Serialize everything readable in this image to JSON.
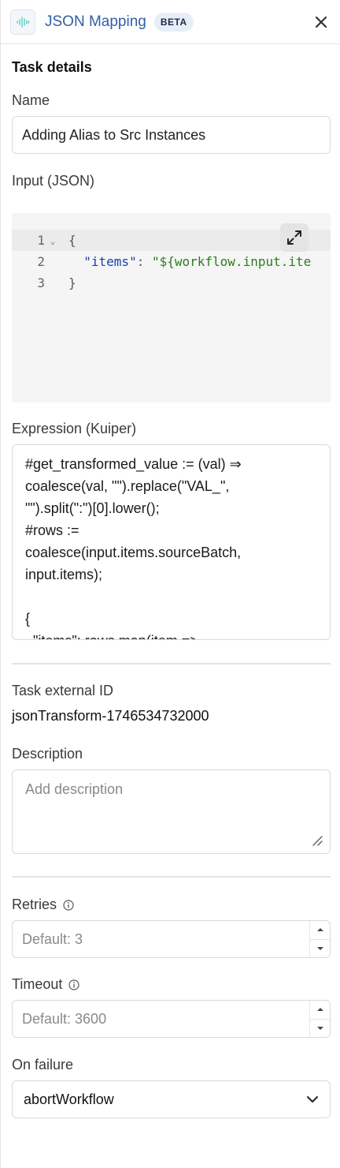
{
  "header": {
    "title": "JSON Mapping",
    "badge": "BETA"
  },
  "task_details": {
    "section_title": "Task details",
    "name_label": "Name",
    "name_value": "Adding Alias to Src Instances",
    "input_label": "Input (JSON)",
    "input_code": {
      "line_numbers": [
        "1",
        "2",
        "3"
      ],
      "line1": "{",
      "line2_key": "\"items\"",
      "line2_colon": ": ",
      "line2_value": "\"${workflow.input.ite",
      "line3": "}"
    },
    "expression_label": "Expression (Kuiper)",
    "expression_lines": [
      "#get_transformed_value := (val) ⇒",
      "coalesce(val, \"\").replace(\"VAL_\",",
      "\"\").split(\":\")[0].lower();",
      "#rows :=",
      "coalesce(input.items.sourceBatch,",
      "input.items);",
      "",
      "{",
      "  \"items\": rows.map(item =>"
    ],
    "external_id_label": "Task external ID",
    "external_id_value": "jsonTransform-1746534732000",
    "description_label": "Description",
    "description_placeholder": "Add description",
    "retries_label": "Retries",
    "retries_placeholder": "Default: 3",
    "timeout_label": "Timeout",
    "timeout_placeholder": "Default: 3600",
    "on_failure_label": "On failure",
    "on_failure_value": "abortWorkflow"
  }
}
